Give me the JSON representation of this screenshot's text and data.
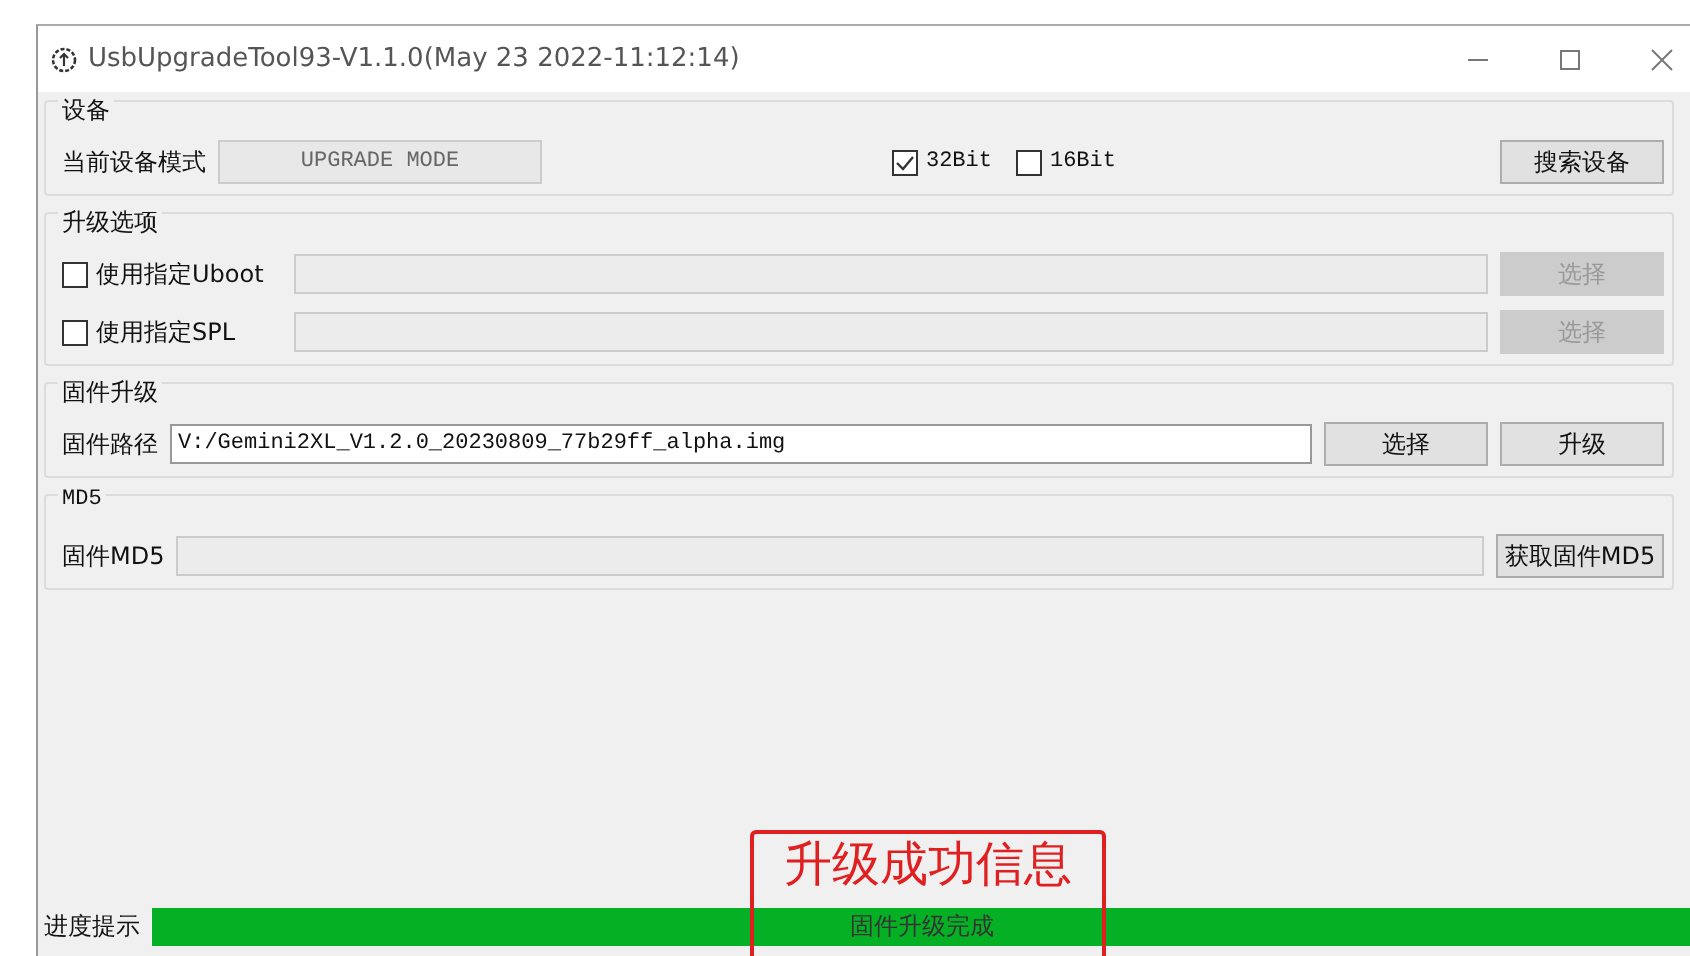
{
  "window": {
    "title": "UsbUpgradeTool93-V1.1.0(May 23 2022-11:12:14)"
  },
  "device": {
    "title": "设备",
    "mode_label": "当前设备模式",
    "mode_value": "UPGRADE MODE",
    "options": [
      {
        "label": "32Bit",
        "checked": true
      },
      {
        "label": "16Bit",
        "checked": false
      }
    ],
    "search_button": "搜索设备"
  },
  "upgrade_options": {
    "title": "升级选项",
    "rows": [
      {
        "label": "使用指定Uboot",
        "checked": false,
        "button": "选择",
        "disabled": true
      },
      {
        "label": "使用指定SPL",
        "checked": false,
        "button": "选择",
        "disabled": true
      }
    ]
  },
  "firmware": {
    "title": "固件升级",
    "path_label": "固件路径",
    "path_value": "V:/Gemini2XL_V1.2.0_20230809_77b29ff_alpha.img",
    "select_button": "选择",
    "upgrade_button": "升级"
  },
  "md5": {
    "title": "MD5",
    "label": "固件MD5",
    "button": "获取固件MD5"
  },
  "progress": {
    "label": "进度提示",
    "level": 1,
    "text": "固件升级完成"
  },
  "annotation": {
    "text": "升级成功信息"
  }
}
